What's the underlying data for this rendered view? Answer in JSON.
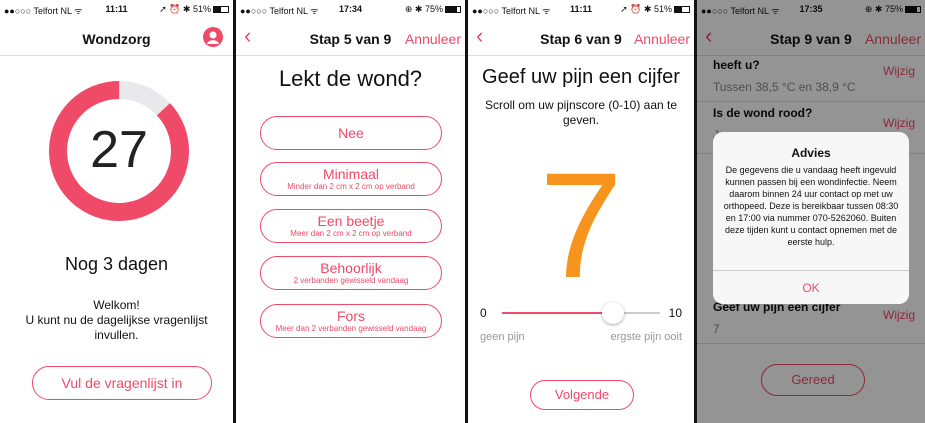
{
  "colors": {
    "accent": "#ef4a68",
    "score": "#f7941d",
    "ring_track": "#e9e9ec"
  },
  "screens": [
    {
      "status": {
        "carrier": "●●○○○ Telfort NL ᯤ",
        "time": "11:11",
        "right": "➚ ⏰ ✱ 51%",
        "battery": 0.51
      },
      "title": "Wondzorg",
      "ring": {
        "value": "27",
        "progress": 0.87
      },
      "days_left": "Nog 3 dagen",
      "welcome": [
        "Welkom!",
        "U kunt nu de dagelijkse vragenlijst",
        "invullen."
      ],
      "button": "Vul de vragenlijst in"
    },
    {
      "status": {
        "carrier": "●●○○○ Telfort NL ᯤ",
        "time": "17:34",
        "right": "⊕ ✱ 75%",
        "battery": 0.75
      },
      "title": "Stap 5 van 9",
      "cancel": "Annuleer",
      "question": "Lekt de wond?",
      "options": [
        {
          "label": "Nee",
          "sub": ""
        },
        {
          "label": "Minimaal",
          "sub": "Minder dan 2 cm x 2 cm op verband"
        },
        {
          "label": "Een beetje",
          "sub": "Meer dan 2 cm x 2 cm op verband"
        },
        {
          "label": "Behoorlijk",
          "sub": "2 verbanden gewisseld vandaag"
        },
        {
          "label": "Fors",
          "sub": "Meer dan 2 verbanden gewisseld vandaag"
        }
      ]
    },
    {
      "status": {
        "carrier": "●●○○○ Telfort NL ᯤ",
        "time": "11:11",
        "right": "➚ ⏰ ✱ 51%",
        "battery": 0.51
      },
      "title": "Stap 6 van 9",
      "cancel": "Annuleer",
      "question": "Geef uw pijn een cijfer",
      "subtitle": "Scroll om uw pijnscore (0-10) aan te geven.",
      "score": "7",
      "slider": {
        "min": "0",
        "max": "10",
        "value": 7,
        "min_label": "geen pijn",
        "max_label": "ergste pijn ooit"
      },
      "button": "Volgende"
    },
    {
      "status": {
        "carrier": "●●○○○ Telfort NL ᯤ",
        "time": "17:35",
        "right": "⊕ ✱ 75%",
        "battery": 0.75
      },
      "title": "Stap 9 van 9",
      "cancel": "Annuleer",
      "rows": [
        {
          "question": "heeft u?",
          "answer": "Tussen 38,5 °C en 38,9 °C",
          "edit": "Wijzig"
        },
        {
          "question": "Is de wond rood?",
          "answer": "Ja",
          "edit": "Wijzig"
        },
        {
          "question": "Geef uw pijn een cijfer",
          "answer": "7",
          "edit": "Wijzig"
        }
      ],
      "button": "Gereed",
      "alert": {
        "title": "Advies",
        "message": "De gegevens die u vandaag heeft ingevuld kunnen passen bij een wondinfectie. Neem daarom binnen 24 uur contact op met uw orthopeed. Deze is bereikbaar tussen 08:30 en 17:00 via nummer 070-5262060. Buiten deze tijden kunt u contact opnemen met de eerste hulp.",
        "ok": "OK"
      }
    }
  ]
}
